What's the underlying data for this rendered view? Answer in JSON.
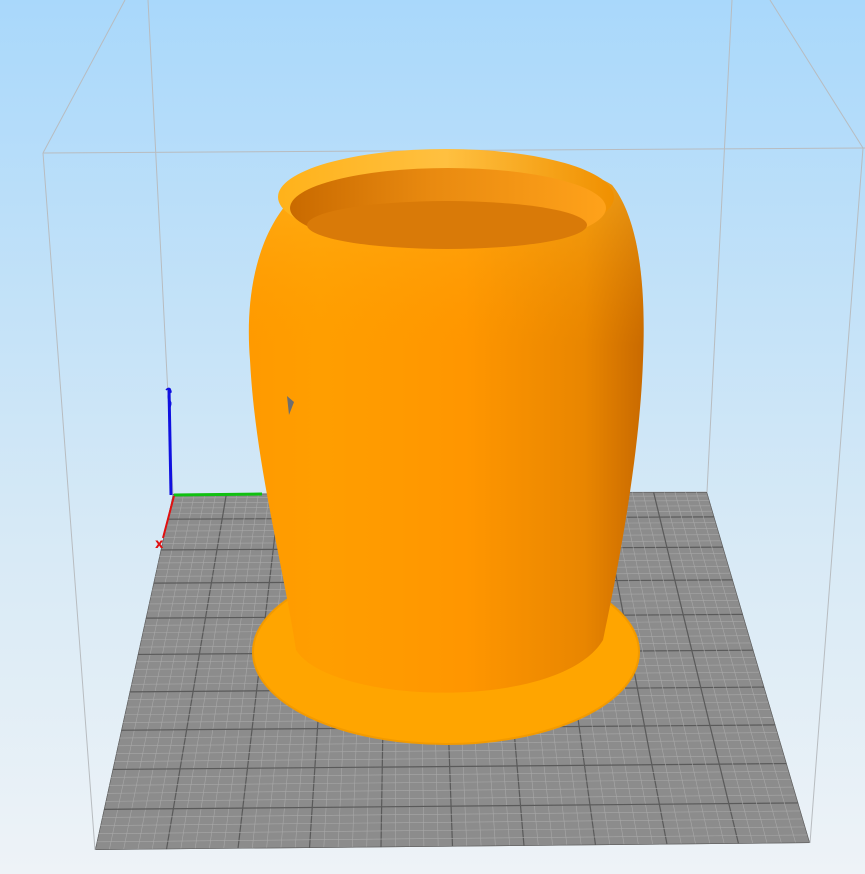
{
  "scene": {
    "background_top_color": "#a9d8fb",
    "background_bottom_color": "#eef3f7",
    "bed_color": "#8c8c8c",
    "bed_grid_minor_color": "#a8a8a8",
    "bed_grid_major_color": "#5a5a5a",
    "build_volume_edge_color": "#b8bcc0",
    "model_color": "#ff9a00",
    "model_shadow_color": "#c96a00",
    "model_highlight_color": "#ffb21a",
    "brim_color": "#ffa500"
  },
  "axes": {
    "x_label": "x",
    "x_color": "#e01010",
    "y_color": "#10c010",
    "z_color": "#1010e0"
  }
}
